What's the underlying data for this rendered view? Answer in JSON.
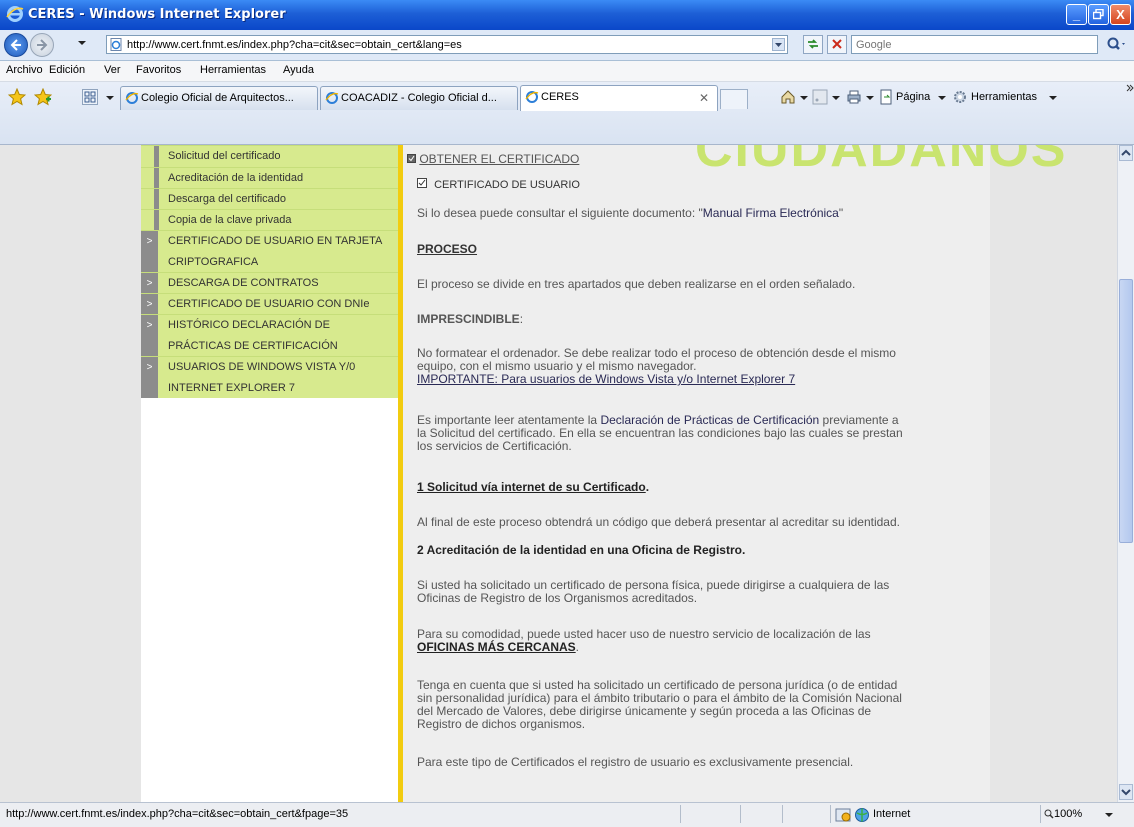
{
  "window": {
    "title": "CERES - Windows Internet Explorer",
    "minimize": "_",
    "maximize": "▫",
    "close": "X"
  },
  "address": {
    "url": "http://www.cert.fnmt.es/index.php?cha=cit&sec=obtain_cert&lang=es",
    "search_placeholder": "Google"
  },
  "menu": [
    "Archivo",
    "Edición",
    "Ver",
    "Favoritos",
    "Herramientas",
    "Ayuda"
  ],
  "tabs": [
    {
      "label": "Colegio Oficial de Arquitectos...",
      "active": false
    },
    {
      "label": "COACADIZ - Colegio Oficial d...",
      "active": false
    },
    {
      "label": "CERES",
      "active": true
    }
  ],
  "commands": {
    "page": "Página",
    "tools": "Herramientas"
  },
  "sidebar": {
    "items": [
      {
        "label": "Solicitud del certificado",
        "sub": true
      },
      {
        "label": "Acreditación de la identidad",
        "sub": true
      },
      {
        "label": "Descarga del certificado",
        "sub": true
      },
      {
        "label": "Copia de la clave privada",
        "sub": true
      },
      {
        "label": "CERTIFICADO DE USUARIO EN TARJETA CRIPTOGRAFICA",
        "sub": false
      },
      {
        "label": "DESCARGA DE CONTRATOS",
        "sub": false
      },
      {
        "label": "CERTIFICADO DE USUARIO CON DNIe",
        "sub": false
      },
      {
        "label": "HISTÓRICO DECLARACIÓN DE PRÁCTICAS DE CERTIFICACIÓN",
        "sub": false
      },
      {
        "label": "USUARIOS DE WINDOWS VISTA Y/0 INTERNET EXPLORER 7",
        "sub": false
      }
    ],
    "marker": ">"
  },
  "main": {
    "section_title": "OBTENER EL CERTIFICADO",
    "sub_title": "CERTIFICADO DE USUARIO",
    "consult_prefix": "Si lo desea puede consultar el siguiente documento: \"",
    "consult_link": "Manual Firma Electrónica",
    "consult_suffix": "\"",
    "proceso": "PROCESO",
    "proceso_text": "El proceso se divide en tres apartados que deben realizarse en el orden señalado.",
    "imprescindible": "IMPRESCINDIBLE",
    "imprescindible_colon": ":",
    "no_format_1": "No formatear el ordenador. Se debe realizar todo el proceso de obtención desde el mismo",
    "no_format_2": "equipo, con el mismo usuario y el mismo navegador.",
    "importante_link": "IMPORTANTE: Para usuarios de Windows Vista y/o Internet Explorer 7",
    "leer_1a": "Es importante leer atentamente la ",
    "leer_link": "Declaración de Prácticas de Certificación",
    "leer_1b": " previamente a",
    "leer_2": "la Solicitud del certificado. En ella se encuentran las condiciones bajo las cuales se prestan",
    "leer_3": "los servicios de Certificación.",
    "step1_link": "1 Solicitud vía internet de su Certificado",
    "step1_dot": ".",
    "step1_text": "Al final de este proceso obtendrá un código que deberá presentar al acreditar su identidad.",
    "step2_title": "2 Acreditación de la identidad en una Oficina de Registro.",
    "fisica_1": "Si usted ha solicitado un certificado de persona física, puede dirigirse a cualquiera de las",
    "fisica_2": "Oficinas de Registro de los Organismos acreditados.",
    "comodidad_1": "Para su comodidad, puede usted hacer uso de nuestro servicio de localización de las",
    "oficinas_link": "OFICINAS MÁS CERCANAS",
    "oficinas_dot": ".",
    "juridica_1": "Tenga en cuenta que si usted ha solicitado un certificado de persona jurídica (o de entidad",
    "juridica_2": "sin personalidad jurídica) para el ámbito tributario o para el ámbito de la Comisión Nacional",
    "juridica_3": "del Mercado de Valores, debe dirigirse únicamente y según proceda a las Oficinas de",
    "juridica_4": "Registro de dichos organismos.",
    "presencial": "Para este tipo de Certificados el registro de usuario es exclusivamente presencial."
  },
  "status": {
    "url": "http://www.cert.fnmt.es/index.php?cha=cit&sec=obtain_cert&fpage=35",
    "zone": "Internet",
    "zoom": "100%"
  },
  "colors": {
    "sidebar_green": "#d7ea8e",
    "accent_yellow": "#f2cc10",
    "titlebar_blue": "#0a47c9"
  }
}
